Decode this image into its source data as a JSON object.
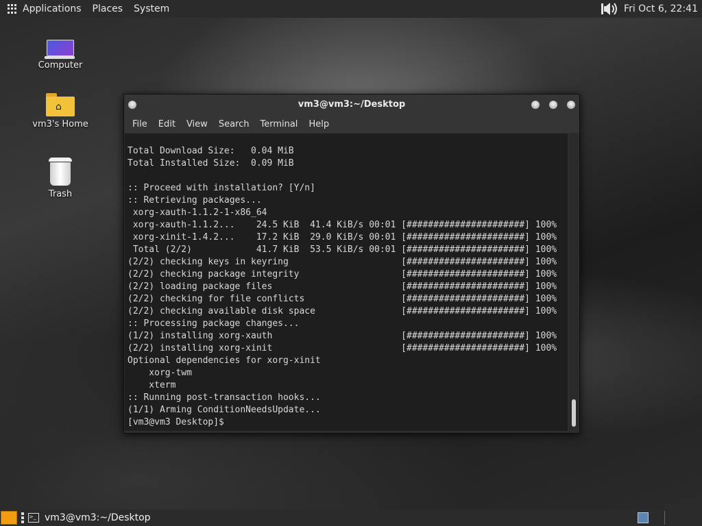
{
  "top_panel": {
    "menus": [
      "Applications",
      "Places",
      "System"
    ],
    "clock": "Fri Oct  6, 22:41"
  },
  "desktop": {
    "icons": [
      {
        "label": "Computer",
        "icon": "computer-icon"
      },
      {
        "label": "vm3's Home",
        "icon": "home-folder-icon"
      },
      {
        "label": "Trash",
        "icon": "trash-icon"
      }
    ]
  },
  "terminal": {
    "title": "vm3@vm3:~/Desktop",
    "menu": [
      "File",
      "Edit",
      "View",
      "Search",
      "Terminal",
      "Help"
    ],
    "lines": [
      "Total Download Size:   0.04 MiB",
      "Total Installed Size:  0.09 MiB",
      "",
      ":: Proceed with installation? [Y/n]",
      ":: Retrieving packages...",
      " xorg-xauth-1.1.2-1-x86_64",
      " xorg-xauth-1.1.2...    24.5 KiB  41.4 KiB/s 00:01 [######################] 100%",
      " xorg-xinit-1.4.2...    17.2 KiB  29.0 KiB/s 00:01 [######################] 100%",
      " Total (2/2)            41.7 KiB  53.5 KiB/s 00:01 [######################] 100%",
      "(2/2) checking keys in keyring                     [######################] 100%",
      "(2/2) checking package integrity                   [######################] 100%",
      "(2/2) loading package files                        [######################] 100%",
      "(2/2) checking for file conflicts                  [######################] 100%",
      "(2/2) checking available disk space                [######################] 100%",
      ":: Processing package changes...",
      "(1/2) installing xorg-xauth                        [######################] 100%",
      "(2/2) installing xorg-xinit                        [######################] 100%",
      "Optional dependencies for xorg-xinit",
      "    xorg-twm",
      "    xterm",
      ":: Running post-transaction hooks...",
      "(1/1) Arming ConditionNeedsUpdate...",
      "[vm3@vm3 Desktop]$ "
    ]
  },
  "taskbar": {
    "task_label": "vm3@vm3:~/Desktop"
  }
}
